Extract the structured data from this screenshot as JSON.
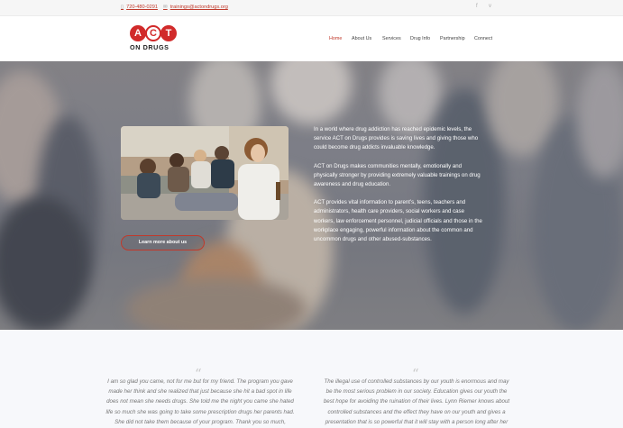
{
  "topbar": {
    "phone": "720-480-0291",
    "email": "trainings@actondrugs.org",
    "social_icons": [
      "facebook-icon",
      "vimeo-icon"
    ]
  },
  "logo": {
    "letters": [
      "A",
      "C",
      "T"
    ],
    "subtitle": "ON DRUGS"
  },
  "nav": {
    "items": [
      {
        "label": "Home",
        "active": true
      },
      {
        "label": "About Us",
        "active": false
      },
      {
        "label": "Services",
        "active": false
      },
      {
        "label": "Drug Info",
        "active": false
      },
      {
        "label": "Partnership",
        "active": false
      },
      {
        "label": "Connect",
        "active": false
      }
    ]
  },
  "hero": {
    "button_label": "Learn more about us",
    "paragraphs": [
      "In a world where drug addiction has reached epidemic levels, the service ACT on Drugs provides is saving lives and giving those who could become drug addicts invaluable knowledge.",
      "ACT on Drugs makes communities mentally, emotionally and physically stronger by providing extremely valuable trainings on drug awareness and drug education.",
      "ACT provides vital information to parent’s, teens, teachers and administrators, health care providers, social workers and case workers, law enforcement personnel, judicial officials and those in the workplace engaging, powerful information about the common and uncommon drugs and other abused-substances."
    ]
  },
  "testimonials": {
    "quote_glyph": "“",
    "items": [
      "I am so glad you came, not for me but for my friend. The program you gave made her think and she realized that just because she hit a bad spot in life does not mean she needs drugs. She told me the night you came she hated life so much she was going to take some prescription drugs her parents had. She did not take them because of your program. Thank you so much, because of your program she is still alive and getting her life",
      "The illegal use of controlled substances by our youth is enormous and may be the most serious problem in our society.  Education gives our youth the best hope for avoiding the ruination of their lives.  Lynn Riemer knows about controlled substances and the effect they have on our youth and gives a presentation that is so powerful that it will stay with a person long after her presentation has concluded.  I would recommend her"
    ]
  },
  "colors": {
    "accent": "#c0392b",
    "logo_red": "#d12a2a",
    "testimonial_bg": "#f7f8fb"
  }
}
